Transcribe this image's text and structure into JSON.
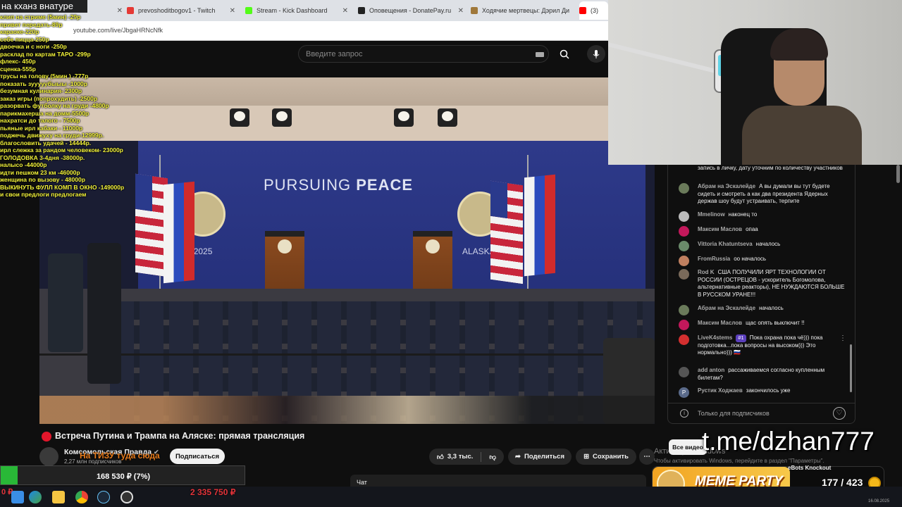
{
  "browser": {
    "tabs": [
      {
        "title": "",
        "color": "#ffffff"
      },
      {
        "title": "prevoshoditbogov1 - Twitch",
        "color": "#e53935"
      },
      {
        "title": "Stream - Kick Dashboard",
        "color": "#53fc18"
      },
      {
        "title": "Оповещения - DonatePay.ru",
        "color": "#222222"
      },
      {
        "title": "Ходячие мертвецы: Дэрил Ди",
        "color": "#a0783a"
      },
      {
        "title": "(3)",
        "color": "#ff0000"
      }
    ],
    "url": "youtube.com/live/JbgaHRNcNfk"
  },
  "overlay": {
    "title": "на кханз внатуре",
    "donations": [
      "клип на стриме (5мин) -29р",
      "привет передать-89р",
      "караоке-220р",
      "себе пицца-250р",
      "двоечка и с ноги -250р",
      "расклад по картам ТАРО -299р",
      "флекс- 450р",
      "сценка-555р",
      "трусы на голову (5мин ) -777р",
      "показать зууууубыыы -1000р",
      "безумная кулинария- 2300р",
      "заказ игры (попрохудить) -2500р",
      "разорвать футболку на груди -4800р",
      "парикмахерша на домм-5500р",
      "нахратси до талого - 7500р",
      "пьяные ирл кабаки - 11000р",
      "поджечь движуху на груди-12999р.",
      "благословить удачей - 14444р.",
      "ирл слежка за рандом человеком- 23000р",
      "ГОЛОДОВКА 3-4дня -38000р.",
      "налысо -44000р",
      "идти пешком 23 км -46000р",
      "женщина по вызову - 48000р",
      "ВЫКИНУТЬ ФУЛЛ КОМП В ОКНО -149000р",
      "и свои предлоги предлогаем"
    ],
    "ribbon": "На ТИЗУ туда сюда",
    "goal_text": "168 530 ₽ (7%)",
    "goal_fraction": 0.07,
    "zero": "0 ₽",
    "sum": "2 335 750 ₽",
    "telegram": "t.me/dzhan777",
    "meme_title": "MEME PARTY",
    "meme_count": "177 / 423",
    "knockout": "eBots Knockout"
  },
  "youtube": {
    "search_placeholder": "Введите запрос",
    "video": {
      "banner_bold": "PEACE",
      "banner_thin": "PURSUING",
      "alaska_left": "ASKA 2025",
      "alaska_right": "ALASKA"
    },
    "title": "Встреча Путина и Трампа на Аляске: прямая трансляция",
    "channel": "Комсомольская Правда",
    "subs": "2,27 млн подписчиков",
    "subscribe": "Подписаться",
    "likes": "3,3 тыс.",
    "share": "Поделиться",
    "save": "Сохранить",
    "all_videos": "Все видео",
    "chat_tab": "Чат"
  },
  "chat": {
    "messages": [
      {
        "author": "",
        "text": "запись в личку, дату уточним по количеству участников",
        "avatar": ""
      },
      {
        "author": "Абрам на Эскалейде",
        "text": "А вы думали вы тут будете сидеть и смотреть а как два президента Ядерных держав шоу будут устраивать, терпите",
        "avatar": "#6a7a5a"
      },
      {
        "author": "Mmelinow",
        "text": "наконец то",
        "avatar": "#bbbbbb"
      },
      {
        "author": "Максим Маслов",
        "text": "опаа",
        "avatar": "#c2185b"
      },
      {
        "author": "Vittoria Khatuntseva",
        "text": "началось",
        "avatar": "#6a8a6a"
      },
      {
        "author": "FromRussia",
        "text": "оо началось",
        "avatar": "#c08060"
      },
      {
        "author": "Rod K",
        "text": "США ПОЛУЧИЛИ ЯРТ ТЕХНОЛОГИИ ОТ РОССИИ (ОСТРЕЦОВ - ускоритель Богомолова, альтернативные реакторы), НЕ НУЖДАЮТСЯ БОЛЬШЕ В РУССКОМ УРАНЕ!!!",
        "avatar": "#7a6a5a"
      },
      {
        "author": "Абрам на Эскалейде",
        "text": "началось",
        "avatar": "#6a7a5a"
      },
      {
        "author": "Максим Маслов",
        "text": "щас опять выключит !!",
        "avatar": "#c2185b"
      },
      {
        "author": "LiveK4stems",
        "badge": "#1",
        "text": "Пока охрана пока чё))) пока подготовка...пока вопросы на высоком))) Это нормально))) 🇷🇺",
        "avatar": "#d32f2f"
      },
      {
        "author": "add anton",
        "text": "рассаживаемся согласно купленным билетам?",
        "avatar": "#555555"
      },
      {
        "author": "Рустик Ходжаев",
        "text": "закончилось уже",
        "avatar": "#5a6a8a",
        "initial": "Р"
      }
    ],
    "footer": "Только для подписчиков"
  },
  "windows": {
    "activate_title": "Активация Windows",
    "activate_text": "Чтобы активировать Windows, перейдите в раздел \"Параметры\".",
    "date": "16.08.2025"
  },
  "colors": {
    "youtube_red": "#e3162b",
    "goal_green": "#29b837",
    "donation_yellow": "#f2f23a"
  }
}
